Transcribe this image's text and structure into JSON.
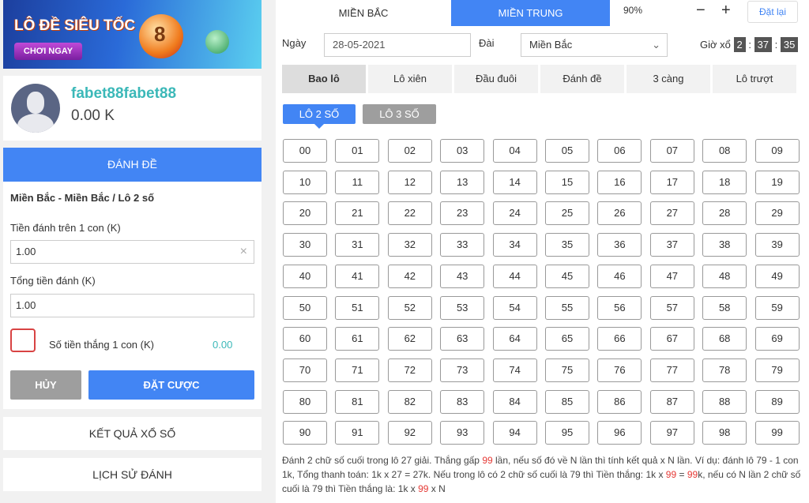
{
  "banner": {
    "title": "LÔ ĐỀ SIÊU TỐC",
    "cta": "CHƠI NGAY",
    "ball_number": "8"
  },
  "user": {
    "name": "fabet88fabet88",
    "balance": "0.00 K"
  },
  "bet": {
    "header": "ĐÁNH ĐỀ",
    "selection": "Miền Bắc - Miền Bắc / Lô 2 số",
    "amount_label": "Tiền đánh trên 1 con (K)",
    "amount_value": "1.00",
    "total_label": "Tổng tiền đánh (K)",
    "total_value": "1.00",
    "win_label": "Số tiền thắng 1 con (K)",
    "win_value": "0.00",
    "cancel": "HỦY",
    "place": "ĐẶT CƯỢC"
  },
  "nav": {
    "results": "KẾT QUẢ XỔ SỐ",
    "history": "LỊCH SỬ ĐÁNH"
  },
  "regions": {
    "north": "MIỀN BẮC",
    "central": "MIỀN TRUNG",
    "active": "MIỀN TRUNG"
  },
  "zoom": {
    "value": "90%",
    "minus": "−",
    "plus": "+",
    "reset": "Đặt lại"
  },
  "filters": {
    "date_label": "Ngày",
    "date_value": "28-05-2021",
    "station_label": "Đài",
    "station_value": "Miền Bắc",
    "draw_label": "Giờ xổ",
    "draw_h": "2",
    "draw_m": "37",
    "draw_s": "35"
  },
  "tabs": [
    "Bao lô",
    "Lô xiên",
    "Đầu đuôi",
    "Đánh đề",
    "3 càng",
    "Lô trượt"
  ],
  "active_tab": "Bao lô",
  "subtabs": [
    "LÔ 2 SỐ",
    "LÔ 3 SỐ"
  ],
  "numbers": [
    "00",
    "01",
    "02",
    "03",
    "04",
    "05",
    "06",
    "07",
    "08",
    "09",
    "10",
    "11",
    "12",
    "13",
    "14",
    "15",
    "16",
    "17",
    "18",
    "19",
    "20",
    "21",
    "22",
    "23",
    "24",
    "25",
    "26",
    "27",
    "28",
    "29",
    "30",
    "31",
    "32",
    "33",
    "34",
    "35",
    "36",
    "37",
    "38",
    "39",
    "40",
    "41",
    "42",
    "43",
    "44",
    "45",
    "46",
    "47",
    "48",
    "49",
    "50",
    "51",
    "52",
    "53",
    "54",
    "55",
    "56",
    "57",
    "58",
    "59",
    "60",
    "61",
    "62",
    "63",
    "64",
    "65",
    "66",
    "67",
    "68",
    "69",
    "70",
    "71",
    "72",
    "73",
    "74",
    "75",
    "76",
    "77",
    "78",
    "79",
    "80",
    "81",
    "82",
    "83",
    "84",
    "85",
    "86",
    "87",
    "88",
    "89",
    "90",
    "91",
    "92",
    "93",
    "94",
    "95",
    "96",
    "97",
    "98",
    "99"
  ],
  "rules": {
    "p1": "Đánh 2 chữ số cuối trong lô 27 giải. Thắng gấp ",
    "m1": "99",
    "p2": " lần, nếu số đó về N lần thì tính kết quả x N lần. Ví dụ: đánh lô 79 - 1 con 1k, Tổng thanh toán: 1k x 27 = 27k. Nếu trong lô có 2 chữ số cuối là 79 thì Tiền thắng: 1k x ",
    "m2": "99",
    "p3": " = ",
    "m3": "99",
    "p4": "k, nếu có N lần 2 chữ số cuối là 79 thì Tiền thắng là: 1k x ",
    "m4": "99",
    "p5": " x N"
  },
  "colors": {
    "primary": "#4285f4",
    "accent": "#3bb8b8",
    "highlight": "#e53935"
  }
}
